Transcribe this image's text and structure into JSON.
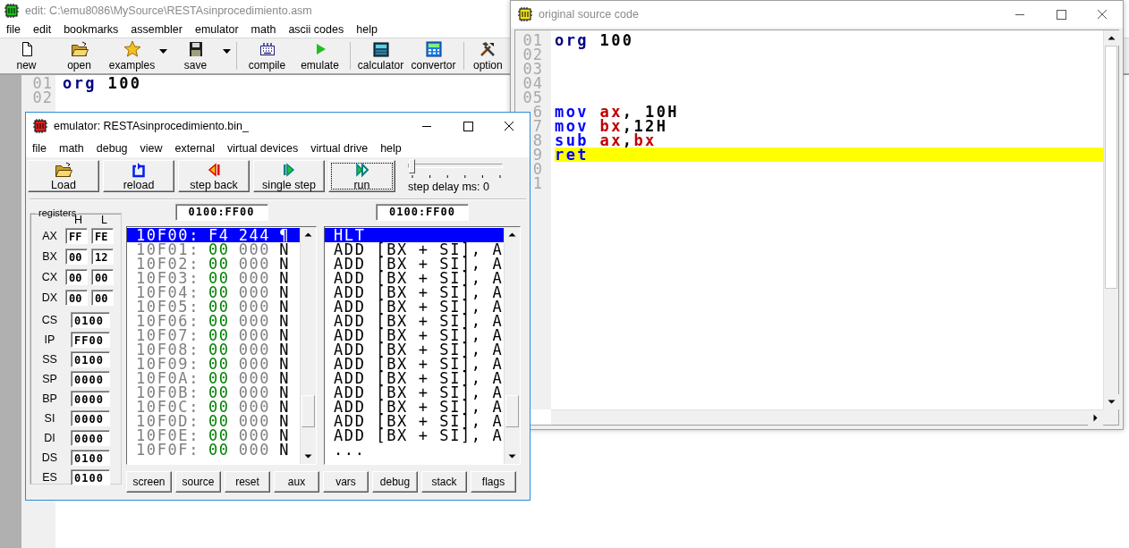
{
  "editor_window": {
    "title": "edit: C:\\emu8086\\MySource\\RESTAsinprocedimiento.asm",
    "menu": [
      "file",
      "edit",
      "bookmarks",
      "assembler",
      "emulator",
      "math",
      "ascii codes",
      "help"
    ],
    "toolbar": [
      [
        {
          "label": "new",
          "dropdown": false
        },
        {
          "label": "open",
          "dropdown": false
        },
        {
          "label": "examples",
          "dropdown": true
        },
        {
          "label": "save",
          "dropdown": true
        }
      ],
      [
        {
          "label": "compile",
          "dropdown": false
        },
        {
          "label": "emulate",
          "dropdown": false
        }
      ],
      [
        {
          "label": "calculator",
          "dropdown": false
        },
        {
          "label": "convertor",
          "dropdown": false
        }
      ],
      [
        {
          "label": "option",
          "dropdown": false
        }
      ]
    ],
    "lines": [
      {
        "number": "01",
        "tokens": [
          {
            "text": "org",
            "kind": "directive"
          },
          {
            "text": " 100",
            "kind": "text"
          }
        ]
      },
      {
        "number": "02"
      }
    ]
  },
  "source_window": {
    "title": "original source code",
    "lines": [
      {
        "number": "01",
        "highlighted": false,
        "tokens": [
          {
            "text": "org",
            "kind": "directive"
          },
          {
            "text": " 100",
            "kind": "text"
          }
        ]
      },
      {
        "number": "02",
        "highlighted": false
      },
      {
        "number": "03",
        "highlighted": false
      },
      {
        "number": "04",
        "highlighted": false
      },
      {
        "number": "05",
        "highlighted": false
      },
      {
        "number": "6",
        "highlighted": false,
        "tokens": [
          {
            "text": "mov",
            "kind": "keyword"
          },
          {
            "text": " ax",
            "kind": "register"
          },
          {
            "text": ", 10H",
            "kind": "text"
          }
        ]
      },
      {
        "number": "7",
        "highlighted": false,
        "tokens": [
          {
            "text": "mov",
            "kind": "keyword"
          },
          {
            "text": " bx",
            "kind": "register"
          },
          {
            "text": ",12H",
            "kind": "text"
          }
        ]
      },
      {
        "number": "8",
        "highlighted": false,
        "tokens": [
          {
            "text": "sub",
            "kind": "keyword"
          },
          {
            "text": " ax",
            "kind": "register"
          },
          {
            "text": ",",
            "kind": "text"
          },
          {
            "text": "bx",
            "kind": "register"
          }
        ]
      },
      {
        "number": "9",
        "highlighted": true,
        "tokens": [
          {
            "text": "ret",
            "kind": "keyword"
          }
        ]
      },
      {
        "number": "0",
        "highlighted": false
      },
      {
        "number": "1",
        "highlighted": false
      }
    ]
  },
  "emulator_window": {
    "title": "emulator: RESTAsinprocedimiento.bin_",
    "menu": [
      "file",
      "math",
      "debug",
      "view",
      "external",
      "virtual devices",
      "virtual drive",
      "help"
    ],
    "toolbar": [
      {
        "label": "Load",
        "focused": false
      },
      {
        "label": "reload",
        "focused": false
      },
      {
        "label": "step back",
        "focused": false
      },
      {
        "label": "single step",
        "focused": false
      },
      {
        "label": "run",
        "focused": true
      }
    ],
    "step_delay": {
      "level": 0,
      "label": "step delay ms: 0"
    },
    "registers": {
      "title": "registers",
      "columns": [
        "H",
        "L"
      ],
      "byte_registers": [
        {
          "name": "AX",
          "high": "FF",
          "low": "FE"
        },
        {
          "name": "BX",
          "high": "00",
          "low": "12"
        },
        {
          "name": "CX",
          "high": "00",
          "low": "00"
        },
        {
          "name": "DX",
          "high": "00",
          "low": "00"
        }
      ],
      "word_registers": [
        {
          "name": "CS",
          "value": "0100"
        },
        {
          "name": "IP",
          "value": "FF00"
        },
        {
          "name": "SS",
          "value": "0100"
        },
        {
          "name": "SP",
          "value": "0000"
        },
        {
          "name": "BP",
          "value": "0000"
        },
        {
          "name": "SI",
          "value": "0000"
        },
        {
          "name": "DI",
          "value": "0000"
        },
        {
          "name": "DS",
          "value": "0100"
        },
        {
          "name": "ES",
          "value": "0100"
        }
      ]
    },
    "memory": {
      "address": "0100:FF00",
      "rows": [
        {
          "address": "10F00:",
          "hex": "F4",
          "dec": "244",
          "char": "¶",
          "selected": true
        },
        {
          "address": "10F01:",
          "hex": "00",
          "dec": "000",
          "char": "N",
          "selected": false
        },
        {
          "address": "10F02:",
          "hex": "00",
          "dec": "000",
          "char": "N",
          "selected": false
        },
        {
          "address": "10F03:",
          "hex": "00",
          "dec": "000",
          "char": "N",
          "selected": false
        },
        {
          "address": "10F04:",
          "hex": "00",
          "dec": "000",
          "char": "N",
          "selected": false
        },
        {
          "address": "10F05:",
          "hex": "00",
          "dec": "000",
          "char": "N",
          "selected": false
        },
        {
          "address": "10F06:",
          "hex": "00",
          "dec": "000",
          "char": "N",
          "selected": false
        },
        {
          "address": "10F07:",
          "hex": "00",
          "dec": "000",
          "char": "N",
          "selected": false
        },
        {
          "address": "10F08:",
          "hex": "00",
          "dec": "000",
          "char": "N",
          "selected": false
        },
        {
          "address": "10F09:",
          "hex": "00",
          "dec": "000",
          "char": "N",
          "selected": false
        },
        {
          "address": "10F0A:",
          "hex": "00",
          "dec": "000",
          "char": "N",
          "selected": false
        },
        {
          "address": "10F0B:",
          "hex": "00",
          "dec": "000",
          "char": "N",
          "selected": false
        },
        {
          "address": "10F0C:",
          "hex": "00",
          "dec": "000",
          "char": "N",
          "selected": false
        },
        {
          "address": "10F0D:",
          "hex": "00",
          "dec": "000",
          "char": "N",
          "selected": false
        },
        {
          "address": "10F0E:",
          "hex": "00",
          "dec": "000",
          "char": "N",
          "selected": false
        },
        {
          "address": "10F0F:",
          "hex": "00",
          "dec": "000",
          "char": "N",
          "selected": false
        }
      ]
    },
    "disassembly": {
      "address": "0100:FF00",
      "rows": [
        {
          "text": "HLT",
          "selected": true
        },
        {
          "text": "ADD [BX + SI], A",
          "selected": false
        },
        {
          "text": "ADD [BX + SI], A",
          "selected": false
        },
        {
          "text": "ADD [BX + SI], A",
          "selected": false
        },
        {
          "text": "ADD [BX + SI], A",
          "selected": false
        },
        {
          "text": "ADD [BX + SI], A",
          "selected": false
        },
        {
          "text": "ADD [BX + SI], A",
          "selected": false
        },
        {
          "text": "ADD [BX + SI], A",
          "selected": false
        },
        {
          "text": "ADD [BX + SI], A",
          "selected": false
        },
        {
          "text": "ADD [BX + SI], A",
          "selected": false
        },
        {
          "text": "ADD [BX + SI], A",
          "selected": false
        },
        {
          "text": "ADD [BX + SI], A",
          "selected": false
        },
        {
          "text": "ADD [BX + SI], A",
          "selected": false
        },
        {
          "text": "ADD [BX + SI], A",
          "selected": false
        },
        {
          "text": "ADD [BX + SI], A",
          "selected": false
        },
        {
          "text": "...",
          "selected": false
        }
      ]
    },
    "buttons": [
      "screen",
      "source",
      "reset",
      "aux",
      "vars",
      "debug",
      "stack",
      "flags"
    ]
  }
}
